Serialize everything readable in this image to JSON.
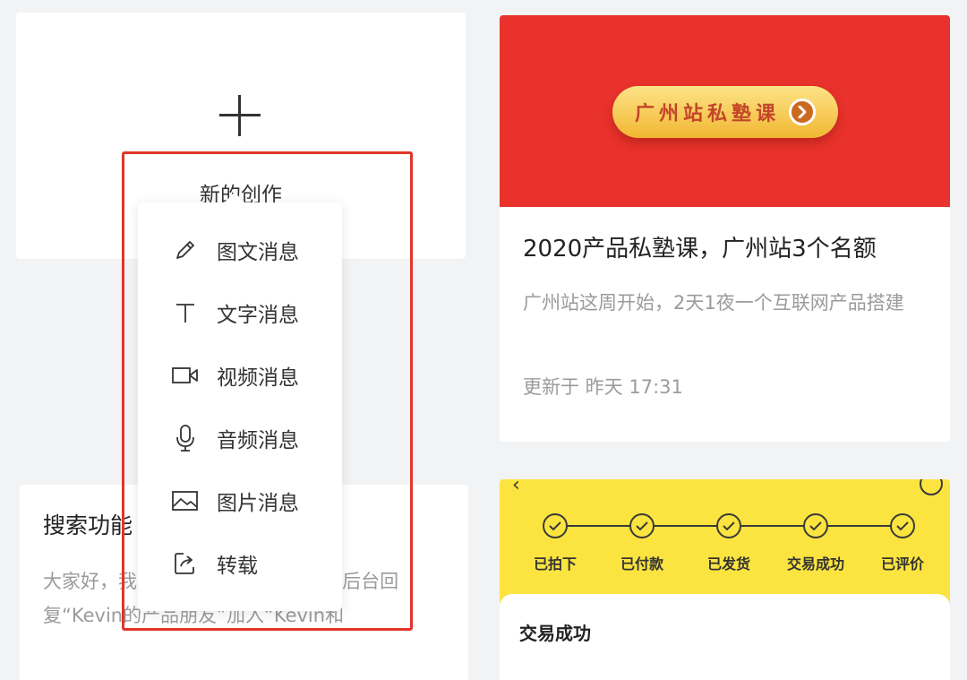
{
  "new_creation": {
    "label": "新的创作"
  },
  "menu": {
    "items": [
      {
        "label": "图文消息",
        "icon": "pencil-icon"
      },
      {
        "label": "文字消息",
        "icon": "text-icon"
      },
      {
        "label": "视频消息",
        "icon": "video-icon"
      },
      {
        "label": "音频消息",
        "icon": "microphone-icon"
      },
      {
        "label": "图片消息",
        "icon": "image-icon"
      },
      {
        "label": "转载",
        "icon": "share-icon"
      }
    ]
  },
  "article_left": {
    "title": "搜索功能",
    "description": "大家好，我…0年第39篇原创公众号后台回复“Kevin的产品朋友”加入“Kevin和"
  },
  "article_right": {
    "banner_text": "广州站私塾课",
    "title": "2020产品私塾课，广州站3个名额",
    "description": "广州站这周开始，2天1夜一个互联网产品搭建",
    "updated": "更新于 昨天 17:31"
  },
  "progress_card": {
    "steps": [
      "已拍下",
      "已付款",
      "已发货",
      "交易成功",
      "已评价"
    ],
    "status_title": "交易成功"
  },
  "colors": {
    "banner_red": "#e8322b",
    "highlight_red": "#e0362a",
    "yellow": "#fbe43f",
    "pill_gold": "#f2b733"
  }
}
